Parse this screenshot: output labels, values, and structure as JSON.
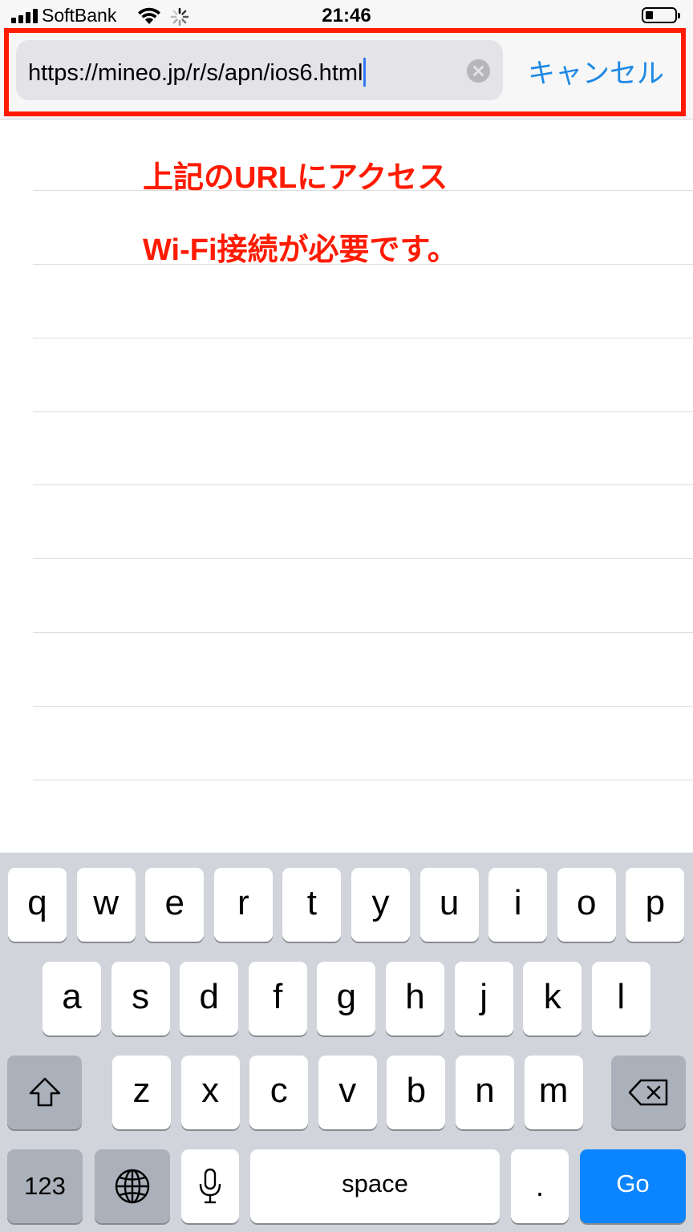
{
  "status_bar": {
    "carrier": "SoftBank",
    "time": "21:46"
  },
  "url_bar": {
    "url_value": "https://mineo.jp/r/s/apn/ios6.html",
    "cancel_label": "キャンセル"
  },
  "annotations": {
    "line1": "上記のURLにアクセス",
    "line2": "Wi-Fi接続が必要です。"
  },
  "colors": {
    "annotation_red": "#ff1a00",
    "link_blue": "#1e88e5",
    "go_blue": "#0a84ff"
  },
  "keyboard": {
    "row1": [
      "q",
      "w",
      "e",
      "r",
      "t",
      "y",
      "u",
      "i",
      "o",
      "p"
    ],
    "row2": [
      "a",
      "s",
      "d",
      "f",
      "g",
      "h",
      "j",
      "k",
      "l"
    ],
    "row3": [
      "z",
      "x",
      "c",
      "v",
      "b",
      "n",
      "m"
    ],
    "numbers_label": "123",
    "space_label": "space",
    "period_label": ".",
    "go_label": "Go",
    "icons": [
      "shift-icon",
      "delete-icon",
      "globe-icon",
      "microphone-icon"
    ]
  }
}
